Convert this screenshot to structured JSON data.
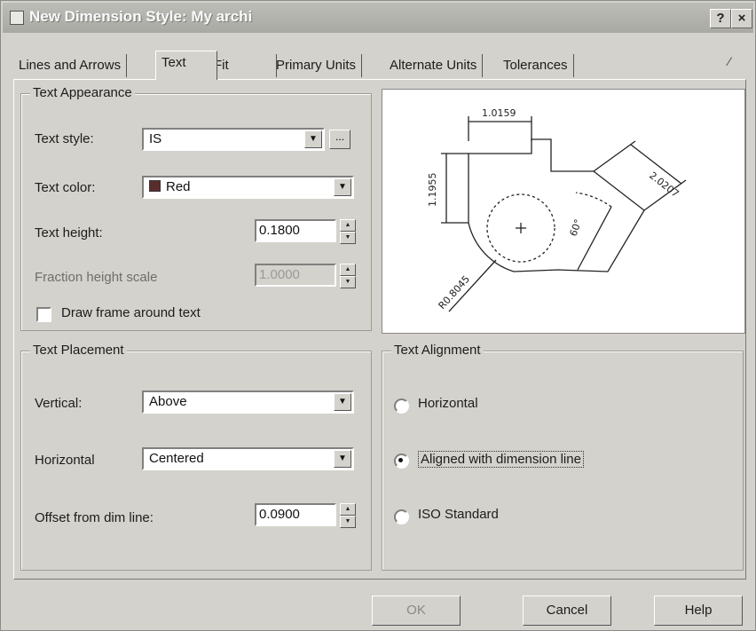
{
  "window": {
    "title": "New Dimension Style: My archi",
    "help_button": "?",
    "close_button": "×"
  },
  "tabs": [
    "Lines and Arrows",
    "Text",
    "Fit",
    "Primary Units",
    "Alternate Units",
    "Tolerances"
  ],
  "text_appearance": {
    "legend": "Text Appearance",
    "style_label": "Text style:",
    "style_value": "IS",
    "style_browse": "...",
    "color_label": "Text color:",
    "color_value": "Red",
    "height_label": "Text height:",
    "height_value": "0.1800",
    "fraction_label": "Fraction height scale",
    "fraction_value": "1.0000",
    "frame_label": "Draw frame around text",
    "frame_checked": false
  },
  "preview": {
    "dim_top": "1.0159",
    "dim_left": "1.1955",
    "dim_right": "2.0207",
    "dim_angle": "60°",
    "dim_radius": "R0.8045"
  },
  "text_placement": {
    "legend": "Text Placement",
    "vertical_label": "Vertical:",
    "vertical_value": "Above",
    "horizontal_label": "Horizontal",
    "horizontal_value": "Centered",
    "offset_label": "Offset from dim line:",
    "offset_value": "0.0900"
  },
  "text_alignment": {
    "legend": "Text Alignment",
    "options": [
      "Horizontal",
      "Aligned with dimension line",
      "ISO Standard"
    ],
    "selected": "Aligned with dimension line"
  },
  "buttons": {
    "ok": "OK",
    "cancel": "Cancel",
    "help": "Help"
  }
}
